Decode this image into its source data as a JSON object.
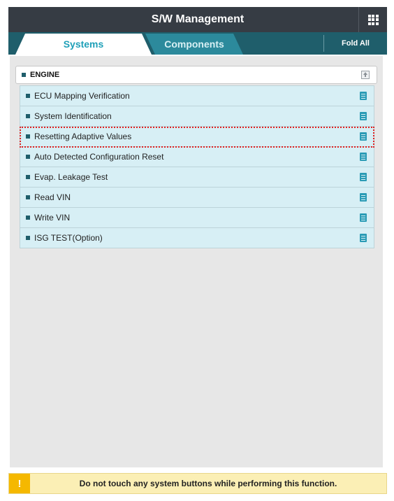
{
  "header": {
    "title": "S/W Management",
    "menu_icon": "grid-icon"
  },
  "tabs": [
    {
      "label": "Systems",
      "active": true
    },
    {
      "label": "Components",
      "active": false
    }
  ],
  "toolbar": {
    "fold_all_label": "Fold All"
  },
  "section": {
    "title": "ENGINE",
    "collapse_icon": "collapse-up-icon",
    "items": [
      {
        "label": "ECU Mapping Verification",
        "icon": "document-icon"
      },
      {
        "label": "System Identification",
        "icon": "document-icon"
      },
      {
        "label": "Resetting Adaptive Values",
        "icon": "document-icon",
        "highlighted": true
      },
      {
        "label": "Auto Detected Configuration Reset",
        "icon": "document-icon"
      },
      {
        "label": "Evap. Leakage Test",
        "icon": "document-icon"
      },
      {
        "label": "Read VIN",
        "icon": "document-icon"
      },
      {
        "label": "Write VIN",
        "icon": "document-icon"
      },
      {
        "label": "ISG TEST(Option)",
        "icon": "document-icon"
      }
    ]
  },
  "notice": {
    "icon": "warning-icon",
    "symbol": "!",
    "message": "Do not touch any system buttons while performing this function."
  },
  "colors": {
    "titlebar": "#363c44",
    "tabbar": "#1f5e6b",
    "accent": "#1fa0b8",
    "item_bg": "#d7eff5",
    "highlight": "#e02020",
    "notice_bg": "#fbefb5",
    "warning": "#f5b800"
  }
}
